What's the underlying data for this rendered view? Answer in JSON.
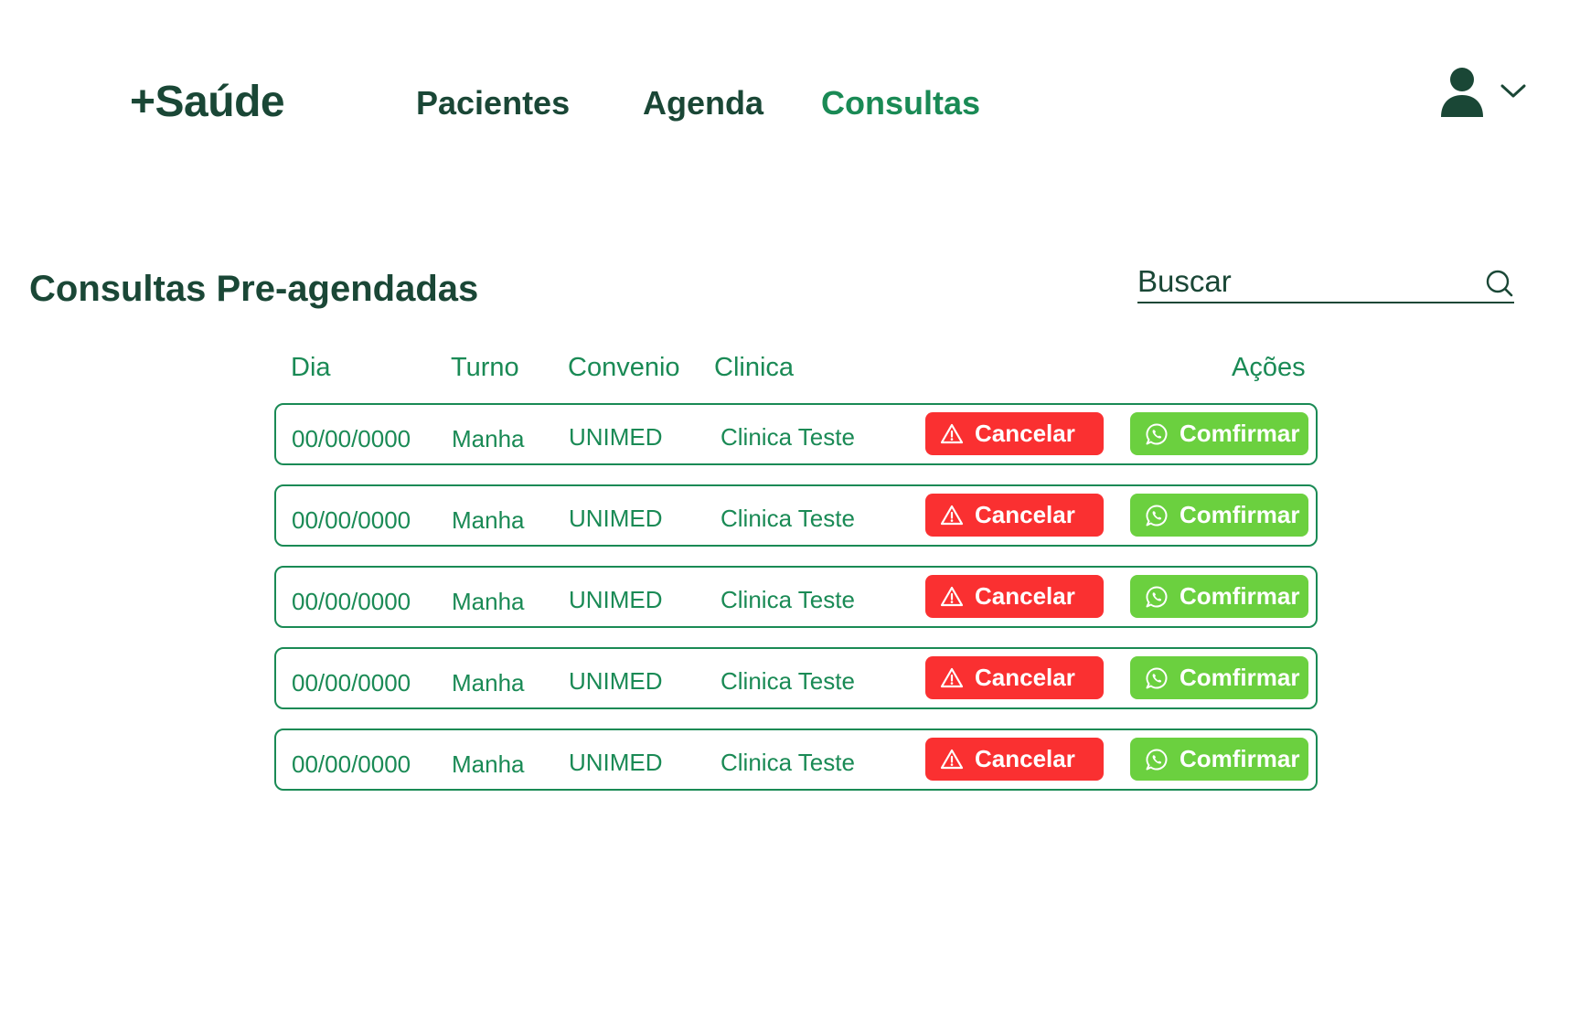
{
  "app": {
    "logo": "+Saúde"
  },
  "nav": {
    "items": [
      {
        "label": "Pacientes",
        "active": false
      },
      {
        "label": "Agenda",
        "active": false
      },
      {
        "label": "Consultas",
        "active": true
      }
    ]
  },
  "user_menu": {
    "icon": "user-icon",
    "dropdown_icon": "chevron-down-icon"
  },
  "page": {
    "title": "Consultas Pre-agendadas"
  },
  "search": {
    "placeholder": "Buscar",
    "value": "",
    "icon": "search-icon"
  },
  "table": {
    "headers": {
      "dia": "Dia",
      "turno": "Turno",
      "convenio": "Convenio",
      "clinica": "Clinica",
      "acoes": "Ações"
    },
    "rows": [
      {
        "dia": "00/00/0000",
        "turno": "Manha",
        "convenio": "UNIMED",
        "clinica": "Clinica Teste"
      },
      {
        "dia": "00/00/0000",
        "turno": "Manha",
        "convenio": "UNIMED",
        "clinica": "Clinica Teste"
      },
      {
        "dia": "00/00/0000",
        "turno": "Manha",
        "convenio": "UNIMED",
        "clinica": "Clinica Teste"
      },
      {
        "dia": "00/00/0000",
        "turno": "Manha",
        "convenio": "UNIMED",
        "clinica": "Clinica Teste"
      },
      {
        "dia": "00/00/0000",
        "turno": "Manha",
        "convenio": "UNIMED",
        "clinica": "Clinica Teste"
      }
    ],
    "actions": {
      "cancel_label": "Cancelar",
      "cancel_icon": "warning-icon",
      "confirm_label": "Comfirmar",
      "confirm_icon": "whatsapp-icon"
    }
  },
  "colors": {
    "primary_dark": "#1a4736",
    "primary": "#1a8a55",
    "cancel": "#fa3031",
    "confirm": "#6bd03f",
    "background": "#ffffff"
  }
}
